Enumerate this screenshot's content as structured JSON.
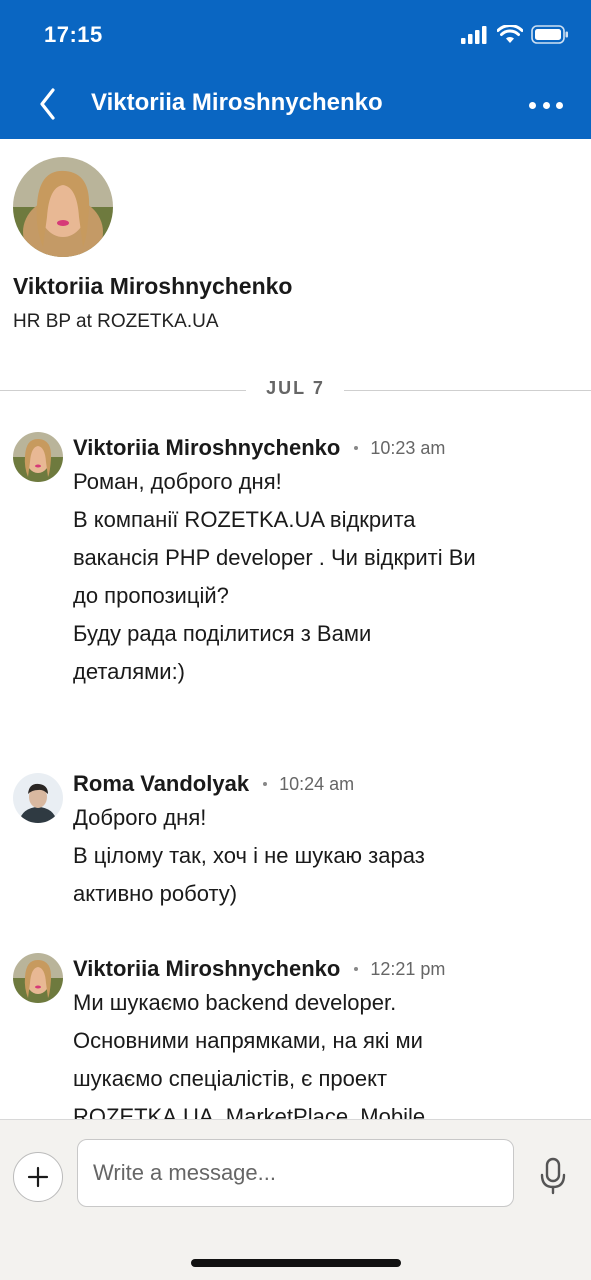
{
  "status_bar": {
    "time": "17:15"
  },
  "header": {
    "title": "Viktoriia Miroshnychenko",
    "accent": "#0a66c2"
  },
  "profile": {
    "name": "Viktoriia Miroshnychenko",
    "headline": "HR BP at ROZETKA.UA"
  },
  "date_divider": "JUL 7",
  "messages": [
    {
      "sender": "Viktoriia Miroshnychenko",
      "time": "10:23 am",
      "lines": [
        "Роман, доброго дня!",
        "В компанії ROZETKA.UA відкрита",
        "вакансія PHP developer . Чи відкриті Ви",
        "до пропозицій?",
        "Буду рада поділитися з Вами",
        "деталями:)"
      ]
    },
    {
      "sender": "Roma Vandolyak",
      "time": "10:24 am",
      "lines": [
        "Доброго дня!",
        "В цілому так, хоч і не шукаю зараз",
        "активно роботу)"
      ]
    },
    {
      "sender": "Viktoriia Miroshnychenko",
      "time": "12:21 pm",
      "lines": [
        "Ми шукаємо backend developer.",
        "Основними напрямками, на які ми",
        "шукаємо спеціалістів, є проект",
        "ROZETKA.UA, MarketPlace, Mobile"
      ]
    }
  ],
  "composer": {
    "placeholder": "Write a message..."
  },
  "icons": {
    "back": "chevron-left-icon",
    "more": "more-dots-icon",
    "plus": "plus-icon",
    "mic": "microphone-icon"
  }
}
